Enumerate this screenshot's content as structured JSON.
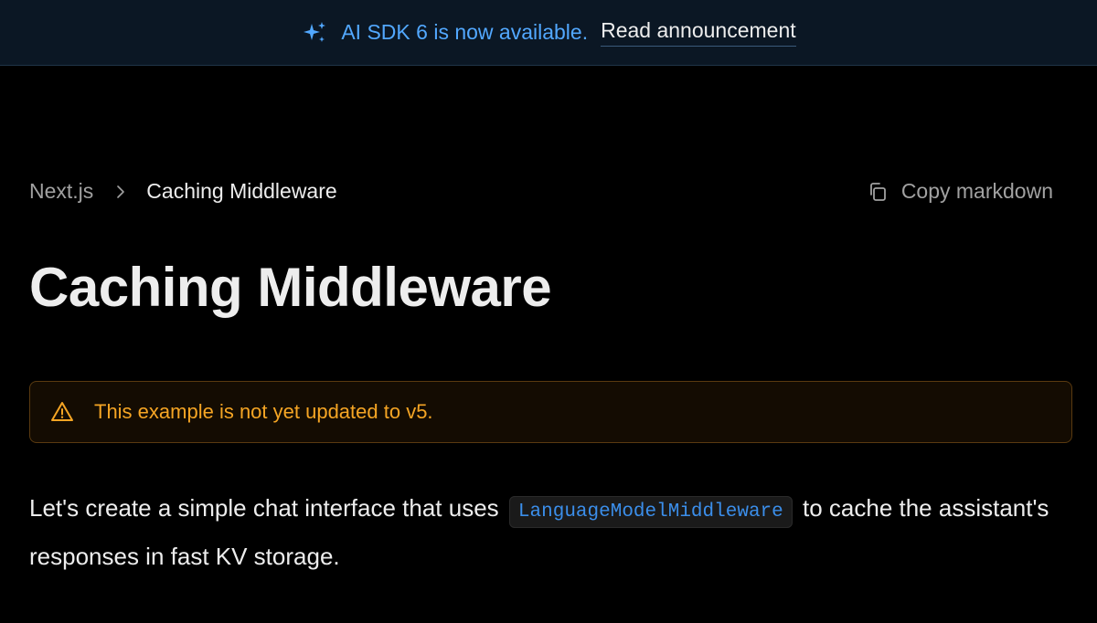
{
  "banner": {
    "icon": "sparkles-icon",
    "text": "AI SDK 6 is now available.",
    "link_label": "Read announcement"
  },
  "breadcrumb": {
    "parent": "Next.js",
    "separator_icon": "chevron-right-icon",
    "current": "Caching Middleware"
  },
  "actions": {
    "copy_icon": "copy-icon",
    "copy_label": "Copy markdown"
  },
  "page": {
    "title": "Caching Middleware"
  },
  "callout": {
    "icon": "warning-triangle-icon",
    "text": "This example is not yet updated to v5."
  },
  "intro": {
    "before_code": "Let's create a simple chat interface that uses ",
    "code": "LanguageModelMiddleware",
    "after_code": " to cache the assistant's responses in fast KV storage."
  },
  "colors": {
    "background": "#000000",
    "banner_bg": "#0b1724",
    "accent_blue": "#52a8ff",
    "warning_amber": "#f5a524",
    "text_primary": "#ededed",
    "text_muted": "#a1a1a1"
  }
}
